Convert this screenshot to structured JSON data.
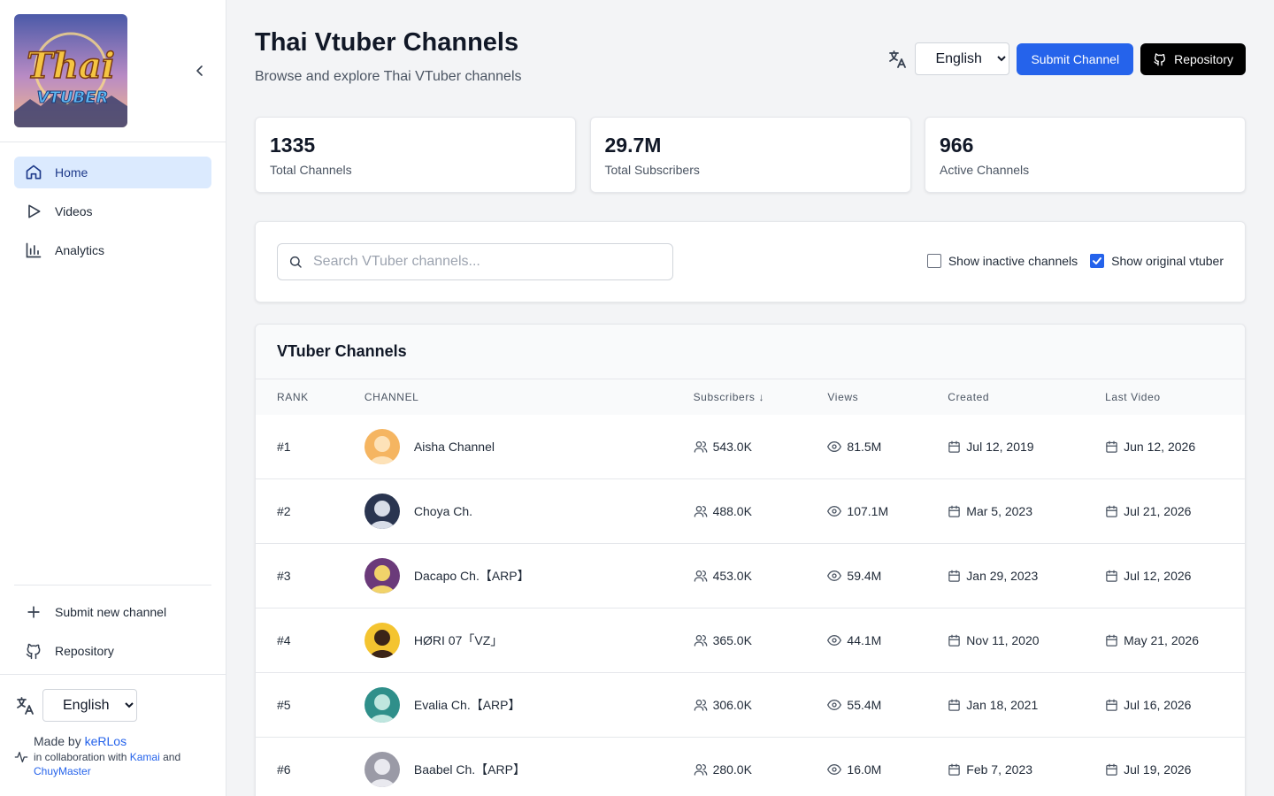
{
  "sidebar": {
    "logo_text": [
      "Thai",
      "VTUBER"
    ],
    "nav": [
      {
        "label": "Home",
        "icon": "home-icon",
        "active": true
      },
      {
        "label": "Videos",
        "icon": "play-icon",
        "active": false
      },
      {
        "label": "Analytics",
        "icon": "bar-chart-icon",
        "active": false
      }
    ],
    "bottom_links": [
      {
        "label": "Submit new channel",
        "icon": "plus-icon"
      },
      {
        "label": "Repository",
        "icon": "github-icon"
      }
    ],
    "language": "English",
    "credits": {
      "made_by_prefix": "Made by",
      "made_by_name": "keRLos",
      "collab_prefix": "in collaboration with",
      "collab_1": "Kamai",
      "collab_and": "and",
      "collab_2": "ChuyMaster"
    }
  },
  "header": {
    "title": "Thai Vtuber Channels",
    "subtitle": "Browse and explore Thai VTuber channels",
    "language": "English",
    "submit_label": "Submit Channel",
    "repo_label": "Repository"
  },
  "stats": [
    {
      "value": "1335",
      "label": "Total Channels"
    },
    {
      "value": "29.7M",
      "label": "Total Subscribers"
    },
    {
      "value": "966",
      "label": "Active Channels"
    }
  ],
  "filters": {
    "search_placeholder": "Search VTuber channels...",
    "show_inactive_label": "Show inactive channels",
    "show_inactive": false,
    "show_original_label": "Show original vtuber",
    "show_original": true
  },
  "table": {
    "title": "VTuber Channels",
    "columns": {
      "rank": "RANK",
      "channel": "CHANNEL",
      "subscribers": "Subscribers ↓",
      "views": "Views",
      "created": "Created",
      "last_video": "Last Video"
    },
    "rows": [
      {
        "rank": "#1",
        "name": "Aisha Channel",
        "subscribers": "543.0K",
        "views": "81.5M",
        "created": "Jul 12, 2019",
        "last_video": "Jun 12, 2026",
        "avatar_bg": "#f5b561",
        "avatar_fg": "#fde2b8"
      },
      {
        "rank": "#2",
        "name": "Choya Ch.",
        "subscribers": "488.0K",
        "views": "107.1M",
        "created": "Mar 5, 2023",
        "last_video": "Jul 21, 2026",
        "avatar_bg": "#2a3550",
        "avatar_fg": "#d8dde8"
      },
      {
        "rank": "#3",
        "name": "Dacapo Ch.【ARP】",
        "subscribers": "453.0K",
        "views": "59.4M",
        "created": "Jan 29, 2023",
        "last_video": "Jul 12, 2026",
        "avatar_bg": "#6b3a7a",
        "avatar_fg": "#f1d36a"
      },
      {
        "rank": "#4",
        "name": "HØRI 07「VZ」",
        "subscribers": "365.0K",
        "views": "44.1M",
        "created": "Nov 11, 2020",
        "last_video": "May 21, 2026",
        "avatar_bg": "#f4c430",
        "avatar_fg": "#3b2418"
      },
      {
        "rank": "#5",
        "name": "Evalia Ch.【ARP】",
        "subscribers": "306.0K",
        "views": "55.4M",
        "created": "Jan 18, 2021",
        "last_video": "Jul 16, 2026",
        "avatar_bg": "#2f8f8a",
        "avatar_fg": "#bfe6df"
      },
      {
        "rank": "#6",
        "name": "Baabel Ch.【ARP】",
        "subscribers": "280.0K",
        "views": "16.0M",
        "created": "Feb 7, 2023",
        "last_video": "Jul 19, 2026",
        "avatar_bg": "#9a9aa6",
        "avatar_fg": "#e9e9ef"
      }
    ]
  }
}
